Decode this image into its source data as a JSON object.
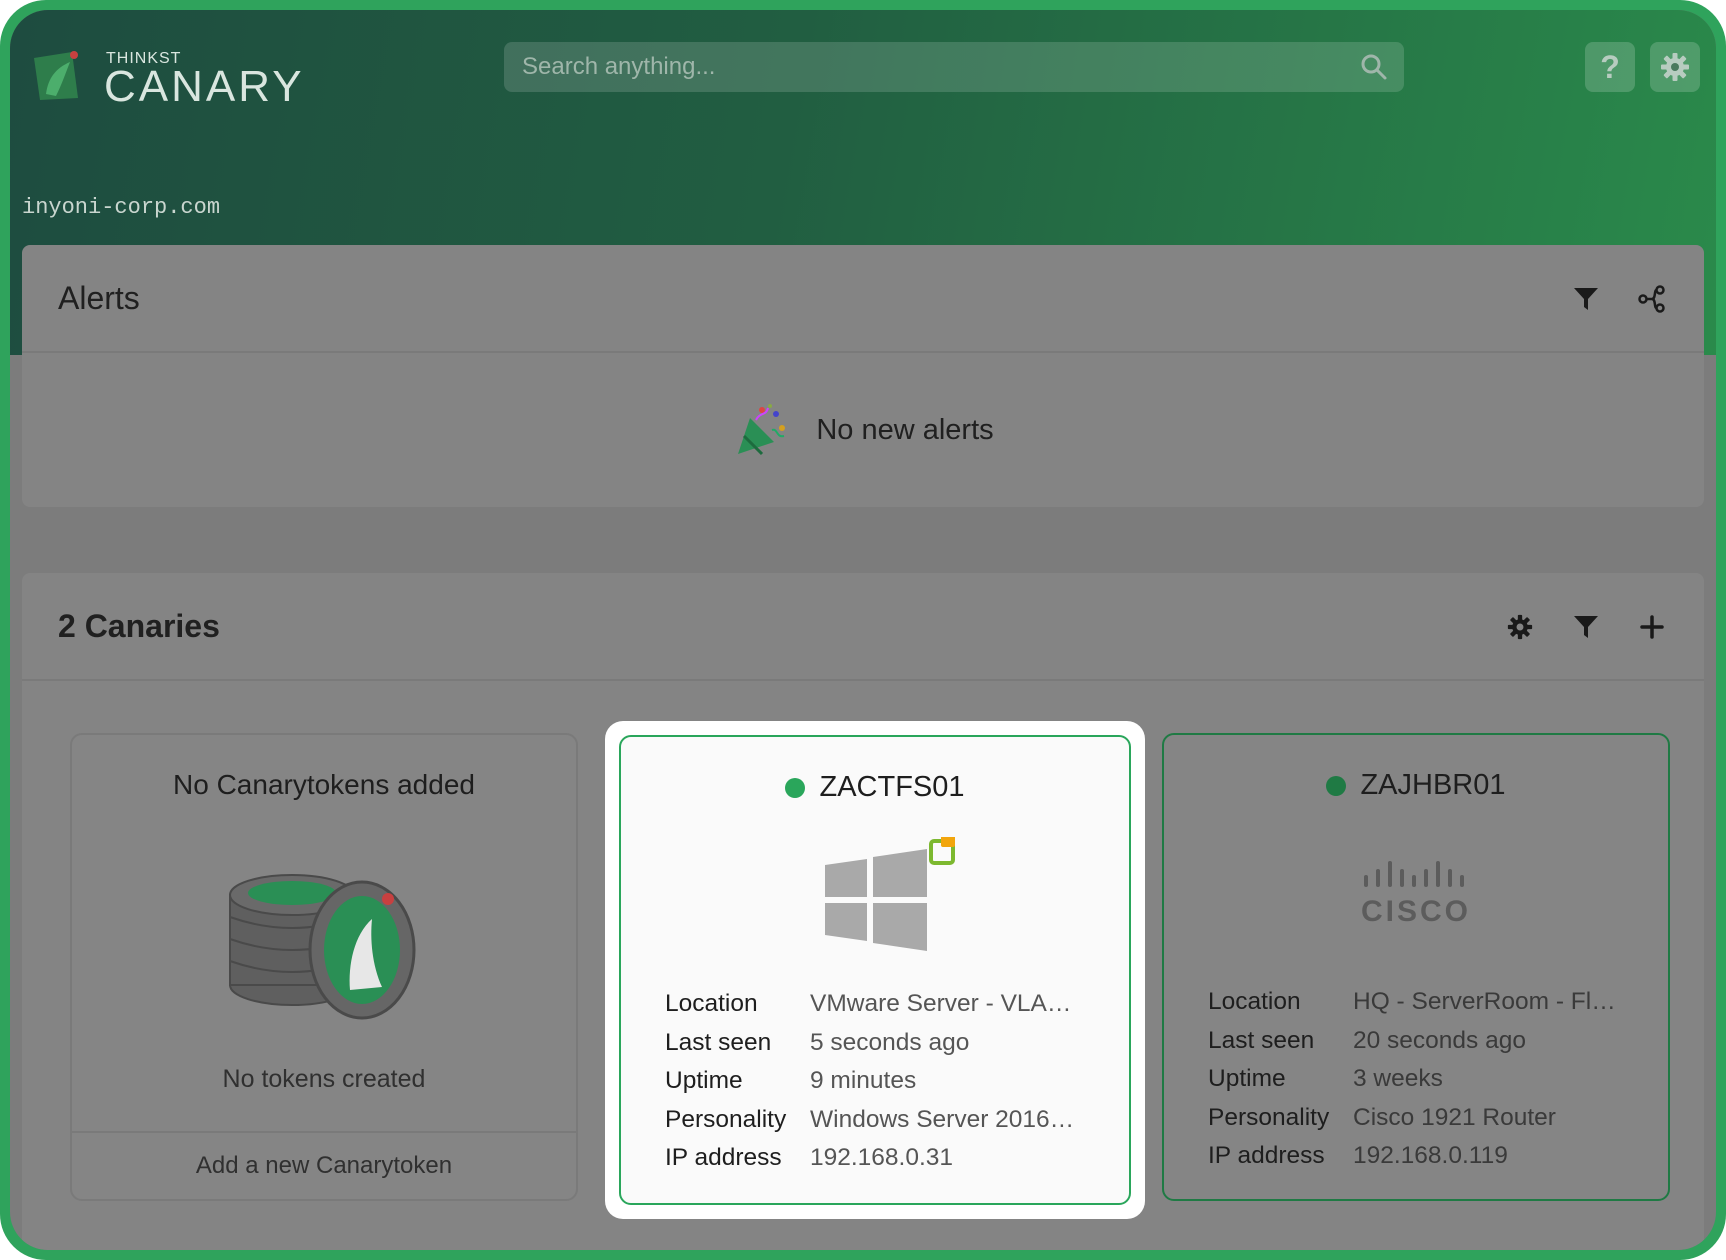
{
  "header": {
    "logo_small": "THINKST",
    "logo_big": "CANARY",
    "search_placeholder": "Search anything...",
    "help_label": "?",
    "domain": "inyoni-corp.com"
  },
  "alerts": {
    "title": "Alerts",
    "empty_message": "No new alerts"
  },
  "canaries": {
    "title": "2 Canaries",
    "tokens_card": {
      "title": "No Canarytokens added",
      "subtitle": "No tokens created",
      "action": "Add a new Canarytoken"
    },
    "devices": [
      {
        "name": "ZACTFS01",
        "logo": "windows-logo",
        "status_color": "#2aa65b",
        "fields": [
          {
            "key": "Location",
            "value": "VMware Server - VLA…"
          },
          {
            "key": "Last seen",
            "value": "5 seconds ago"
          },
          {
            "key": "Uptime",
            "value": "9 minutes"
          },
          {
            "key": "Personality",
            "value": "Windows Server 2016…"
          },
          {
            "key": "IP address",
            "value": "192.168.0.31"
          }
        ]
      },
      {
        "name": "ZAJHBR01",
        "logo": "cisco-logo",
        "logo_text": "CISCO",
        "status_color": "#1f7a44",
        "fields": [
          {
            "key": "Location",
            "value": "HQ - ServerRoom - Fl…"
          },
          {
            "key": "Last seen",
            "value": "20 seconds ago"
          },
          {
            "key": "Uptime",
            "value": "3 weeks"
          },
          {
            "key": "Personality",
            "value": "Cisco 1921 Router"
          },
          {
            "key": "IP address",
            "value": "192.168.0.119"
          }
        ]
      }
    ]
  },
  "colors": {
    "frame": "#2fa35c",
    "accent": "#2aa65b",
    "overlay": "#848484"
  }
}
